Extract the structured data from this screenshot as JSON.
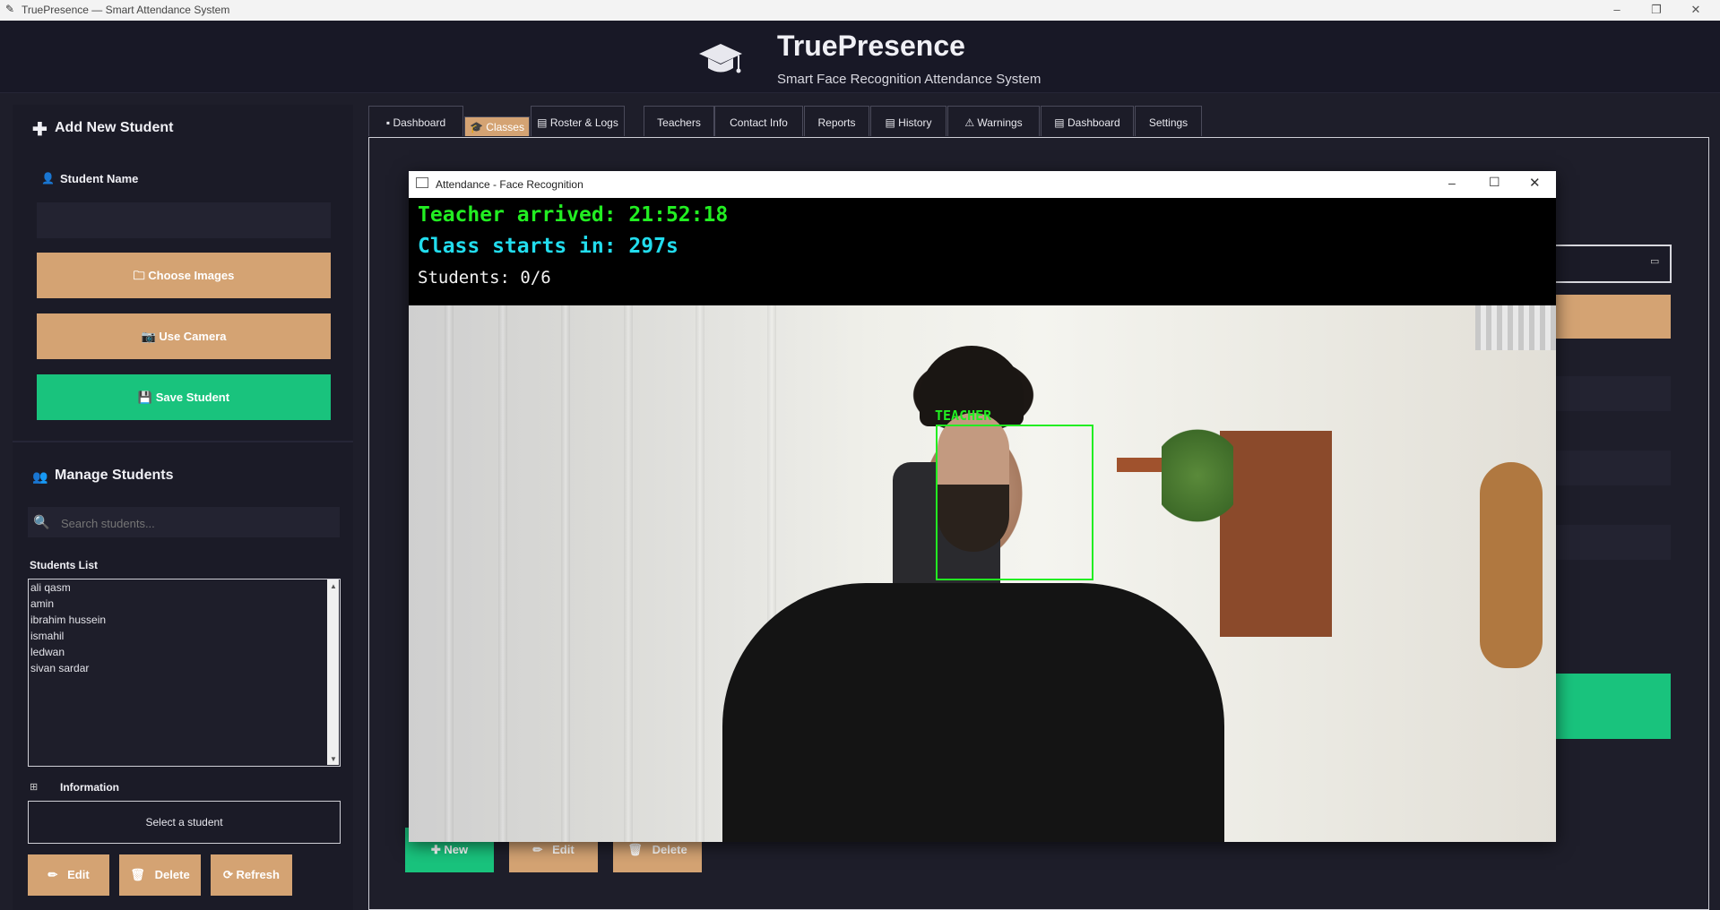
{
  "os_window": {
    "title": "TruePresence — Smart Attendance System",
    "minimize_icon": "–",
    "restore_icon": "❐",
    "close_icon": "✕"
  },
  "header": {
    "logo_icon": "graduation-cap",
    "title": "TruePresence",
    "subtitle": "Smart Face Recognition Attendance System"
  },
  "left_panel": {
    "add_section_title": "Add New Student",
    "student_name_label": "Student Name",
    "student_name_value": "",
    "choose_images_label": "Choose Images",
    "use_camera_label": "Use Camera",
    "save_student_label": "Save Student",
    "manage_section_title": "Manage Students",
    "search_placeholder": "Search students...",
    "students_list_label": "Students List",
    "students": [
      "ali qasm",
      "amin",
      "ibrahim hussein",
      "ismahil",
      "ledwan",
      "sivan sardar"
    ],
    "information_label": "Information",
    "information_value": "Select a student",
    "edit_label": "Edit",
    "delete_label": "Delete",
    "refresh_label": "Refresh"
  },
  "tabs": [
    {
      "label": "Dashboard"
    },
    {
      "label": "Classes"
    },
    {
      "label": "Roster & Logs"
    },
    {
      "label": "Teachers"
    },
    {
      "label": "Contact Info"
    },
    {
      "label": "Reports"
    },
    {
      "label": "History"
    },
    {
      "label": "Warnings"
    },
    {
      "label": "Dashboard"
    },
    {
      "label": "Settings"
    }
  ],
  "active_tab": "Classes",
  "classes_tab": {
    "new_label": "New",
    "edit_label": "Edit",
    "delete_label": "Delete"
  },
  "camera_window": {
    "title": "Attendance - Face Recognition",
    "teacher_arrived": "Teacher arrived: 21:52:18",
    "class_starts": "Class starts in: 297s",
    "students_count": "Students: 0/6",
    "face_label": "TEACHER"
  },
  "colors": {
    "accent_tan": "#d4a373",
    "accent_green": "#19c37d",
    "overlay_green": "#22ee22",
    "overlay_cyan": "#22ddee",
    "background": "#1e1e2a"
  }
}
